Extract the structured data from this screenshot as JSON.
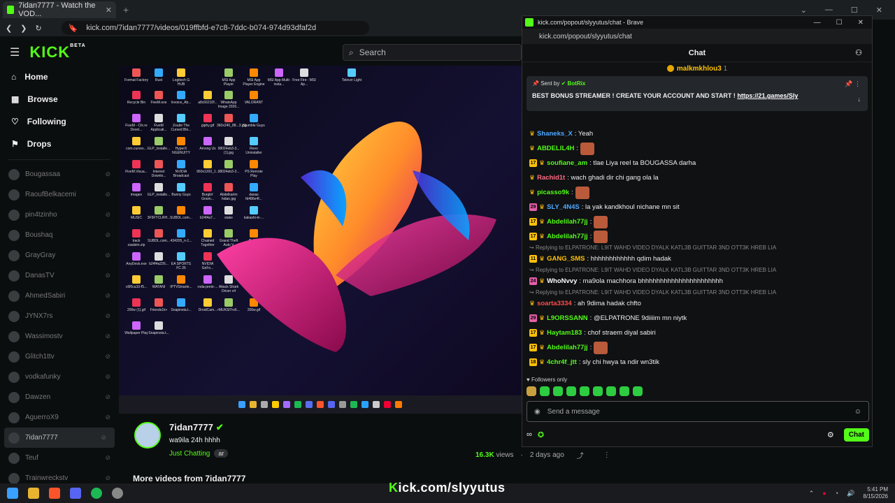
{
  "browser": {
    "tab_title": "7idan7777 - Watch the VOD...",
    "url": "kick.com/7idan7777/videos/019ffbfd-e7c8-7ddc-b074-974d93dfaf2d"
  },
  "kick": {
    "logo": "KICK",
    "beta": "BETA",
    "search_placeholder": "Search",
    "nav": [
      "Home",
      "Browse",
      "Following",
      "Drops"
    ],
    "channels": [
      "Bougassaa",
      "RaoufBelkacemi",
      "pin4tzinho",
      "Boushaq",
      "GrayGray",
      "DanasTV",
      "AhmedSabiri",
      "JYNX7rs",
      "Wassimostv",
      "Glitch1ttv",
      "vodkafunky",
      "Dawzen",
      "AguerroX9",
      "7idan7777",
      "Teuf",
      "Trainwreckstv"
    ]
  },
  "desktop_icons": [
    "Format Factory",
    "Rust",
    "Logitech G HUB",
    "MSI App Player",
    "MSI App Player Engine",
    "MSI App Multi-insta...",
    "Free Fire - MSI Ap...",
    "Televzr Light",
    "Recycle Bin",
    "FiveM.exe",
    "Invoice_Ab...",
    "a8c66210f...",
    "WhatsApp Image 2026...",
    "VALORANT",
    "FiveM - Cfx.re Devel...",
    "FiveM Applicati...",
    "Zoubir The Cursed Blo...",
    "giphy.gif",
    "360x240_88...3.jpg",
    "Stumble Guys",
    "com.curves...",
    "GLP_installe...",
    "HyperX NGENUITY",
    "Among Us",
    "98024eb3-3...(1).jpg",
    "Revo Uninstaller",
    "FiveM.Visua...",
    "Internet Downlo...",
    "NVIDIA Broadcast",
    "960x1200_1...",
    "98024eb3-3...",
    "PS Remote Play",
    "images",
    "GLP_installe...",
    "Bunny Guys",
    "Burglin' Gnom...",
    "Abdelkarim hidan.jpg",
    "danas fd486e4f...",
    "MUSIC",
    "3F5FTCLRH...",
    "SUBDL.com...",
    "b24f4a7...",
    "stake",
    "kakashi-in-...",
    "track zaalsim.zip",
    "SUBDL.com...",
    "434205_n-1...",
    "Chained Together",
    "Grand Theft Auto V",
    "f5d8...",
    "AnyDesk.exe",
    "b24f4a226...",
    "EA SPORTS FC 26",
    "NVIDIA GeFo...",
    "sn...",
    "Stremio",
    "c6f0ca10-f5...",
    "WATANI",
    "IPTVSmarte...",
    "roda-prete-...",
    "Attack Shark Driver v4",
    "dad9c368-...",
    "200w (1).gif",
    "Friends1k+",
    "Snapinsta.t...",
    "DroidCam...",
    "rMUKSf7ro6...",
    "200w.gif",
    "Wallpaper Play",
    "Snapinsta.t..."
  ],
  "streamer": {
    "name": "7idan7777",
    "title": "wa9ila 24h hhhh",
    "category": "Just Chatting",
    "tag": "ar",
    "views": "16.3K",
    "views_label": "views",
    "age": "2 days ago",
    "more": "More videos from 7idan7777"
  },
  "popout": {
    "window_title": "kick.com/popout/slyyutus/chat - Brave",
    "url": "kick.com/popout/slyyutus/chat",
    "chat_title": "Chat",
    "gifter": "malkmkhlou3",
    "gifter_count": "1",
    "pinned_by_label": "Sent by",
    "pinned_by": "BotRix",
    "pinned_msg": "BEST BONUS STREAMER ! CREATE YOUR ACCOUNT AND START !",
    "pinned_link": "https://21.games/Sly",
    "followers_only": "Followers only",
    "input_placeholder": "Send a message",
    "chat_button": "Chat"
  },
  "messages": [
    {
      "user": "Shaneks_X",
      "color": "#4ea8ff",
      "text": ": Yeah",
      "badge": "",
      "emote": false
    },
    {
      "user": "ABDELIL4H",
      "color": "#53fc18",
      "text": ":",
      "badge": "",
      "emote": true
    },
    {
      "user": "soufiane_am",
      "color": "#53fc18",
      "text": ": tlae Liya reel ta BOUGASSA darha",
      "badge": "17",
      "emote": false
    },
    {
      "user": "Rachid1t",
      "color": "#ff6b81",
      "text": ": wach ghadi dir chi gang ola la",
      "badge": "",
      "emote": false
    },
    {
      "user": "picasso9k",
      "color": "#53fc18",
      "text": ":",
      "badge": "",
      "emote": true
    },
    {
      "user": "SLY_4N4S",
      "color": "#4ea8ff",
      "text": ": la yak kandkhoul nichane mn sit",
      "badge": "29",
      "emote": false
    },
    {
      "user": "Abdelilah77jj",
      "color": "#53fc18",
      "text": ":",
      "badge": "17",
      "emote": true
    },
    {
      "user": "Abdelilah77jj",
      "color": "#53fc18",
      "text": ":",
      "badge": "17",
      "emote": true
    },
    {
      "reply": "Replying to ELPATRONE: L9IT WAHD VIDEO DYALK KATL3B GUITTAR 3ND OTT3K HREB LIA"
    },
    {
      "user": "GANG_SMS",
      "color": "#ffc107",
      "text": ": hhhhhhhhhhhh qdim hadak",
      "badge": "11",
      "emote": false
    },
    {
      "reply": "Replying to ELPATRONE: L9IT WAHD VIDEO DYALK KATL3B GUITTAR 3ND OTT3K HREB LIA"
    },
    {
      "user": "WhoNvvy",
      "color": "#ffffff",
      "text": ": ma9ola machhora bhhhhhhhhhhhhhhhhhhhhhh",
      "badge": "24",
      "emote": false
    },
    {
      "reply": "Replying to ELPATRONE: L9IT WAHD VIDEO DYALK KATL3B GUITTAR 3ND OTT3K HREB LIA"
    },
    {
      "user": "soarta3334",
      "color": "#ff4d4d",
      "text": ": ah 9dima hadak chfto",
      "badge": "",
      "emote": false
    },
    {
      "user": "L9ORSSANN",
      "color": "#53fc18",
      "text": ": @ELPATRONE 9diiiim mn niytk",
      "badge": "29",
      "emote": false
    },
    {
      "user": "Haytam183",
      "color": "#53fc18",
      "text": ": chof straem diyal sabiri",
      "badge": "17",
      "emote": false
    },
    {
      "user": "Abdelilah77jj",
      "color": "#53fc18",
      "text": ":",
      "badge": "17",
      "emote": true
    },
    {
      "user": "4chr4f_jtt",
      "color": "#53fc18",
      "text": ": sly chi hwya ta ndir wn3tik",
      "badge": "18",
      "emote": false
    }
  ],
  "overlay": {
    "k": "K",
    "rest": "ick.com/slyyutus"
  },
  "taskbar": {
    "time": "5:41 PM",
    "date": "8/15/2026"
  },
  "colors": {
    "kick_green": "#53fc18",
    "bg": "#0b0e0f"
  }
}
